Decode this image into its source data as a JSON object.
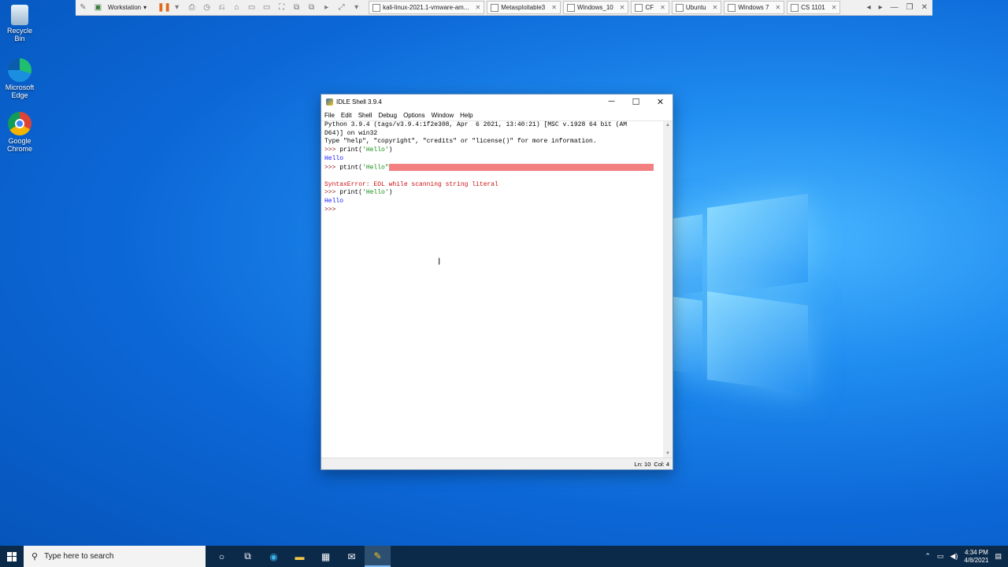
{
  "desktop": {
    "icons": [
      {
        "label": "Recycle Bin"
      },
      {
        "label": "Microsoft Edge"
      },
      {
        "label": "Google Chrome"
      }
    ]
  },
  "vmware": {
    "workstation_label": "Workstation",
    "tabs": [
      {
        "label": "kali-linux-2021.1-vmware-am..."
      },
      {
        "label": "Metasploitable3"
      },
      {
        "label": "Windows_10"
      },
      {
        "label": "CF"
      },
      {
        "label": "Ubuntu"
      },
      {
        "label": "Windows 7"
      },
      {
        "label": "CS 1101"
      }
    ]
  },
  "idle": {
    "title": "IDLE Shell 3.9.4",
    "menu": [
      "File",
      "Edit",
      "Shell",
      "Debug",
      "Options",
      "Window",
      "Help"
    ],
    "lines": {
      "banner1": "Python 3.9.4 (tags/v3.9.4:1f2e308, Apr  6 2021, 13:40:21) [MSC v.1928 64 bit (AM",
      "banner2": "D64)] on win32",
      "banner3": "Type \"help\", \"copyright\", \"credits\" or \"license()\" for more information.",
      "prompt": ">>> ",
      "cmd1_code": "print(",
      "cmd1_str": "'Hello'",
      "cmd1_close": ")",
      "out1": "Hello",
      "cmd2_code": "ptint(",
      "cmd2_str": "'Hello\"",
      "error": "SyntaxError: EOL while scanning string literal",
      "cmd3_code": "print(",
      "cmd3_str": "'Hello'",
      "cmd3_close": ")",
      "out2": "Hello"
    },
    "status": {
      "line": "Ln: 10",
      "col": "Col: 4"
    }
  },
  "taskbar": {
    "search_placeholder": "Type here to search",
    "time": "4:34 PM",
    "date": "4/8/2021"
  }
}
